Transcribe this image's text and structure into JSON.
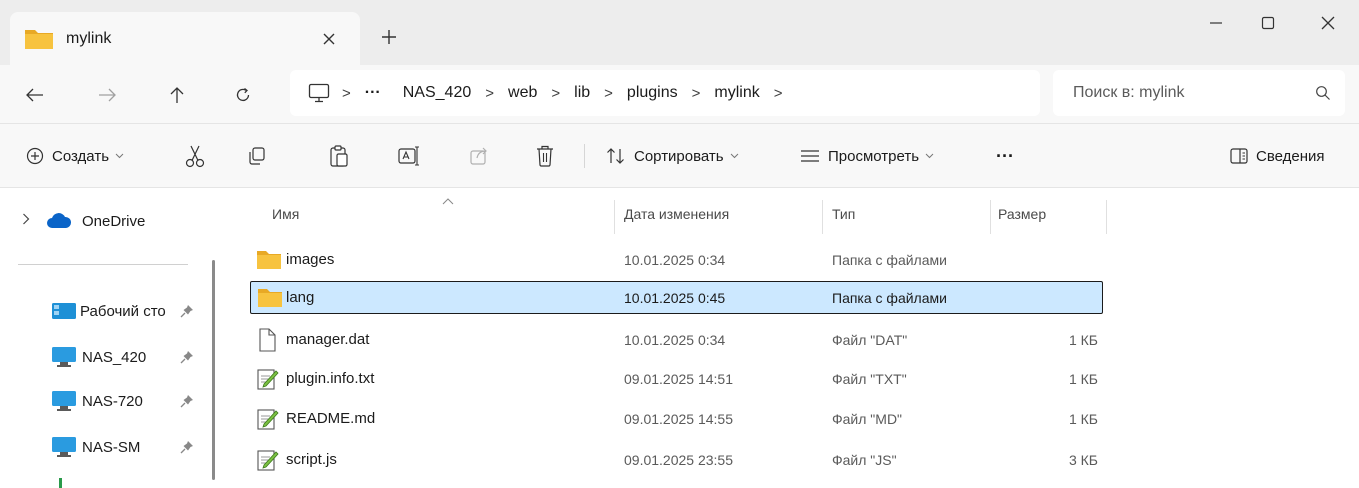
{
  "tab": {
    "title": "mylink"
  },
  "address": {
    "breadcrumbs": [
      "NAS_420",
      "web",
      "lib",
      "plugins",
      "mylink"
    ],
    "overflow": "···"
  },
  "search": {
    "placeholder": "Поиск в: mylink"
  },
  "commandbar": {
    "create_label": "Создать",
    "sort_label": "Сортировать",
    "view_label": "Просмотреть",
    "more_label": "···",
    "details_label": "Сведения"
  },
  "sidebar": {
    "items": [
      {
        "label": "OneDrive",
        "icon": "cloud-icon"
      },
      {
        "label": "Рабочий сто",
        "icon": "desktop-icon",
        "pinned": true
      },
      {
        "label": "NAS_420",
        "icon": "monitor-icon",
        "pinned": true
      },
      {
        "label": "NAS-720",
        "icon": "monitor-icon",
        "pinned": true
      },
      {
        "label": "NAS-SM",
        "icon": "monitor-icon",
        "pinned": true
      }
    ]
  },
  "filelist": {
    "columns": {
      "name": "Имя",
      "date": "Дата изменения",
      "type": "Тип",
      "size": "Размер"
    },
    "rows": [
      {
        "name": "images",
        "date": "10.01.2025 0:34",
        "type": "Папка с файлами",
        "size": "",
        "icon": "folder-icon"
      },
      {
        "name": "lang",
        "date": "10.01.2025 0:45",
        "type": "Папка с файлами",
        "size": "",
        "icon": "folder-icon",
        "selected": true
      },
      {
        "name": "manager.dat",
        "date": "10.01.2025 0:34",
        "type": "Файл \"DAT\"",
        "size": "1 КБ",
        "icon": "file-icon"
      },
      {
        "name": "plugin.info.txt",
        "date": "09.01.2025 14:51",
        "type": "Файл \"TXT\"",
        "size": "1 КБ",
        "icon": "text-file-icon"
      },
      {
        "name": "README.md",
        "date": "09.01.2025 14:55",
        "type": "Файл \"MD\"",
        "size": "1 КБ",
        "icon": "text-file-icon"
      },
      {
        "name": "script.js",
        "date": "09.01.2025 23:55",
        "type": "Файл \"JS\"",
        "size": "3 КБ",
        "icon": "text-file-icon"
      }
    ]
  },
  "colors": {
    "accent_selection": "#cce8ff",
    "folder": "#f7c33f",
    "chrome": "#ededed"
  }
}
